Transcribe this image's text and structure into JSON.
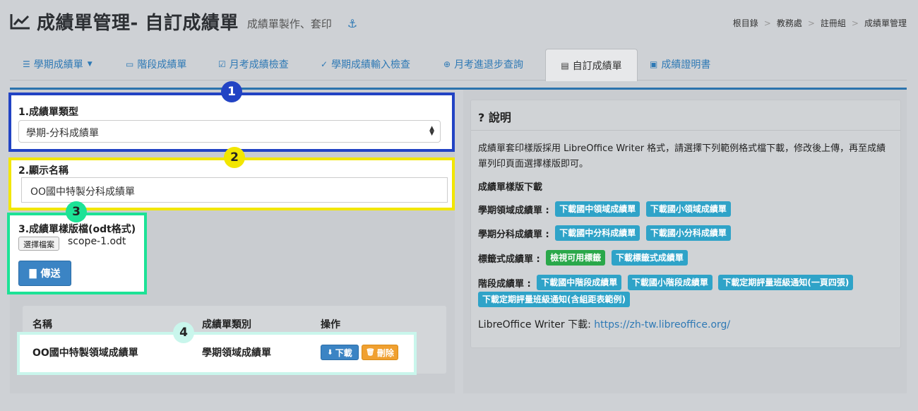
{
  "header": {
    "title": "成績單管理- 自訂成績單",
    "subtitle": "成績單製作、套印"
  },
  "breadcrumb": [
    "根目錄",
    "教務處",
    "註冊組",
    "成績單管理"
  ],
  "tabs": [
    {
      "label": "學期成績單",
      "icon": "list-icon",
      "dropdown": true
    },
    {
      "label": "階段成績單",
      "icon": "card-icon"
    },
    {
      "label": "月考成績檢查",
      "icon": "check-square-icon"
    },
    {
      "label": "學期成績輸入檢查",
      "icon": "check-circle-icon"
    },
    {
      "label": "月考進退步查詢",
      "icon": "zoom-icon"
    },
    {
      "label": "自訂成績單",
      "icon": "newspaper-icon",
      "active": true
    },
    {
      "label": "成績證明書",
      "icon": "id-badge-icon"
    }
  ],
  "form": {
    "type_label": "1.成績單類型",
    "type_value": "學期-分科成績單",
    "name_label": "2.顯示名稱",
    "name_value": "OO國中特製分科成績單",
    "template_label": "3.成績單樣版檔(odt格式)",
    "file_button": "選擇檔案",
    "file_name": "scope-1.odt",
    "upload_button": "傳送"
  },
  "badges": [
    "1",
    "2",
    "3",
    "4"
  ],
  "badge_colors": {
    "1": "#2243c4",
    "2": "#f2e600",
    "3": "#1de296",
    "4": "#c9f6ec"
  },
  "table": {
    "headers": [
      "名稱",
      "成績單類別",
      "操作"
    ],
    "rows": [
      {
        "name": "OO國中特製領域成績單",
        "category": "學期領域成績單",
        "download": "下載",
        "delete": "刪除"
      }
    ]
  },
  "help": {
    "title": "說明",
    "intro": "成績單套印樣版採用 LibreOffice Writer 格式，請選擇下列範例格式檔下載，修改後上傳，再至成績單列印頁面選擇樣版即可。",
    "download_heading": "成績單樣版下載",
    "rows": [
      {
        "label": "學期領域成績單 :",
        "buttons": [
          "下載國中領域成績單",
          "下載國小領域成績單"
        ]
      },
      {
        "label": "學期分科成績單 :",
        "buttons": [
          "下載國中分科成績單",
          "下載國小分科成績單"
        ]
      },
      {
        "label": "標籤式成績單 :",
        "buttons": [
          "檢視可用標籤",
          "下載標籤式成績單"
        ]
      },
      {
        "label": "階段成績單 :",
        "buttons": [
          "下載國中階段成績單",
          "下載國小階段成績單",
          "下載定期評量班級通知(一頁四張)",
          "下載定期評量班級通知(含組距表範例)"
        ]
      }
    ],
    "libre_label": "LibreOffice Writer 下載:",
    "libre_link": "https://zh-tw.libreoffice.org/"
  },
  "colors": {
    "primary": "#2e79b5",
    "info": "#2fa3c8",
    "success": "#2aa84a",
    "warning": "#f0a030"
  }
}
